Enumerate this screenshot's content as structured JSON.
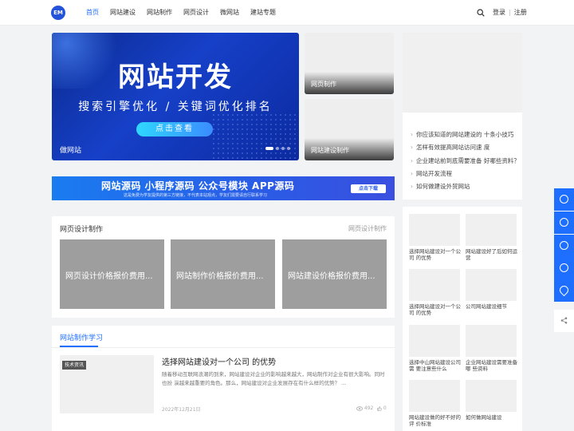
{
  "header": {
    "logo_text": "EM",
    "nav": [
      "首页",
      "网站建设",
      "网站制作",
      "网页设计",
      "微网站",
      "建站专题"
    ],
    "login": "登录",
    "sep": "|",
    "register": "注册"
  },
  "banner": {
    "title": "网站开发",
    "subtitle": "搜索引擎优化  /  关键词优化排名",
    "button": "点击查看",
    "caption": "做网站"
  },
  "side_cards": [
    "网页制作",
    "网站建设制作"
  ],
  "ad": {
    "title": "网站源码 小程序源码 公众号模块 APP源码",
    "subtitle": "这是免费为学友提供的第三方链接，不代表本站观点，学友们需要请自行联系学习",
    "button": "点击下载"
  },
  "section_design": {
    "title": "网页设计制作",
    "more": "网页设计制作",
    "tiles": [
      "网页设计价格报价费用...",
      "网站制作价格报价费用...",
      "网站建设价格报价费用..."
    ]
  },
  "section_articles": {
    "tab": "网站制作学习",
    "article": {
      "tag": "技术资讯",
      "title": "选择网站建设对一个公司 的优势",
      "desc": "随着移动互联网浪潮的到来，网站建设对企业的影响越来越大，网站制作对企业有很大影响。同时也扮 演越来越重要的角色。那么，网站建设对企业发展存在有什么样的优势？ ...",
      "date": "2022年12月21日",
      "views": "492",
      "likes": "0"
    }
  },
  "right_list": [
    "你应该知道的网站建设的 十条小技巧",
    "怎样有效提高网站访问速 度",
    "企业建站前到底需要准备 好哪些资料？",
    "网站开发流程",
    "如何做建设外贸网站"
  ],
  "right_grid": [
    "选择网站建设对一个公司 的优势",
    "网站建设好了后如何运营",
    "选择网站建设对一个公司 的优势",
    "公司网站建设细节",
    "选择中山网站建设公司需 要注意些什么",
    "企业网站建设需要准备哪 些资料",
    "网站建设做的好不好的评 价标准",
    "如何做网站建设"
  ],
  "share_icon": "share-icon",
  "float_icons": [
    "service-icon",
    "wechat-icon",
    "qq-icon",
    "headset-icon",
    "water-icon"
  ],
  "accent_color": "#1e6fff"
}
